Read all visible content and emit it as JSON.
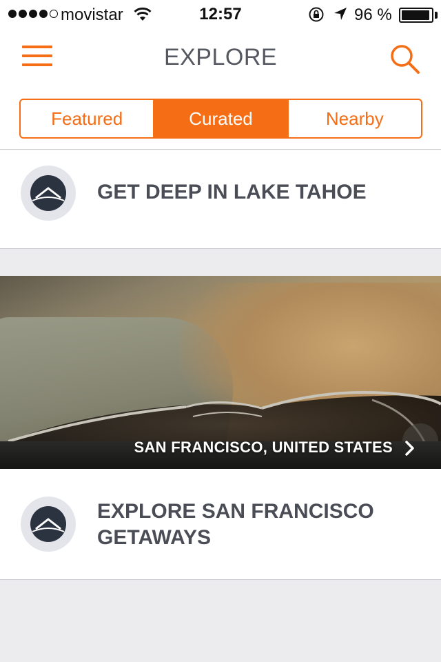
{
  "status_bar": {
    "carrier": "movistar",
    "time": "12:57",
    "battery_percent_text": "96 %",
    "battery_level": 0.96,
    "signal_bars_filled": 4,
    "signal_bars_total": 5
  },
  "nav": {
    "title": "EXPLORE",
    "menu_icon": "hamburger-menu-icon",
    "search_icon": "search-icon"
  },
  "tabs": [
    {
      "label": "Featured",
      "active": false
    },
    {
      "label": "Curated",
      "active": true
    },
    {
      "label": "Nearby",
      "active": false
    }
  ],
  "cards": [
    {
      "title_lines": [
        "GET DEEP IN LAKE TAHOE"
      ],
      "logo_icon": "mountain-logo-icon"
    },
    {
      "title_lines": [
        "EXPLORE SAN FRANCISCO",
        "GETAWAYS"
      ],
      "logo_icon": "mountain-logo-icon"
    }
  ],
  "hero": {
    "caption": "SAN FRANCISCO, UNITED STATES",
    "chevron_icon": "chevron-right-icon"
  },
  "colors": {
    "accent": "#f56d14",
    "text": "#4a4d55",
    "background": "#ececef"
  }
}
